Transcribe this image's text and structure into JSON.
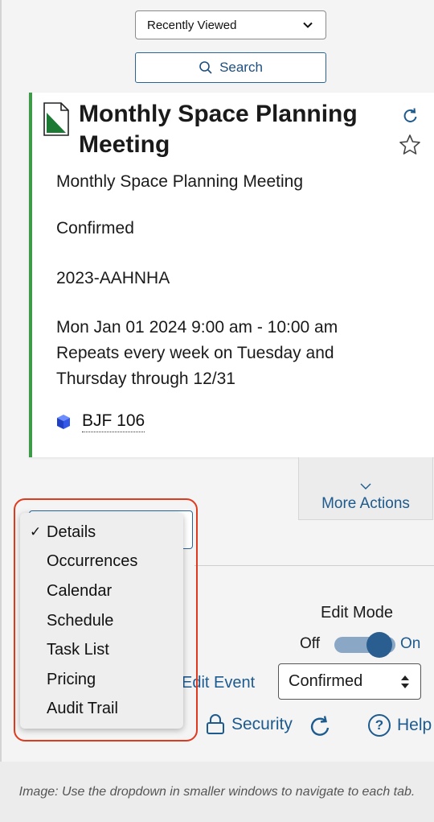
{
  "recently_viewed": {
    "label": "Recently Viewed"
  },
  "search": {
    "label": "Search"
  },
  "event": {
    "title": "Monthly Space Planning Meeting",
    "name": "Monthly Space Planning Meeting",
    "status": "Confirmed",
    "reference": "2023-AAHNHA",
    "schedule": "Mon Jan 01 2024 9:00 am - 10:00 am Repeats every week on Tuesday and Thursday through 12/31",
    "location": "BJF 106"
  },
  "more_actions": {
    "label": "More Actions"
  },
  "tab_menu": {
    "items": [
      {
        "label": "Details",
        "checked": true
      },
      {
        "label": "Occurrences",
        "checked": false
      },
      {
        "label": "Calendar",
        "checked": false
      },
      {
        "label": "Schedule",
        "checked": false
      },
      {
        "label": "Task List",
        "checked": false
      },
      {
        "label": "Pricing",
        "checked": false
      },
      {
        "label": "Audit Trail",
        "checked": false
      }
    ],
    "check_mark": "✓"
  },
  "edit_mode": {
    "label": "Edit Mode",
    "off": "Off",
    "on": "On",
    "enabled": true
  },
  "edit_event": {
    "label": "Edit Event"
  },
  "status_select": {
    "value": "Confirmed"
  },
  "footer": {
    "security": "Security",
    "help": "Help",
    "help_glyph": "?"
  },
  "caption": "Image: Use the dropdown in smaller windows to navigate to each tab.",
  "colors": {
    "accent": "#1d5a8e",
    "event_bar": "#3d9a47",
    "highlight": "#e03a1e"
  }
}
